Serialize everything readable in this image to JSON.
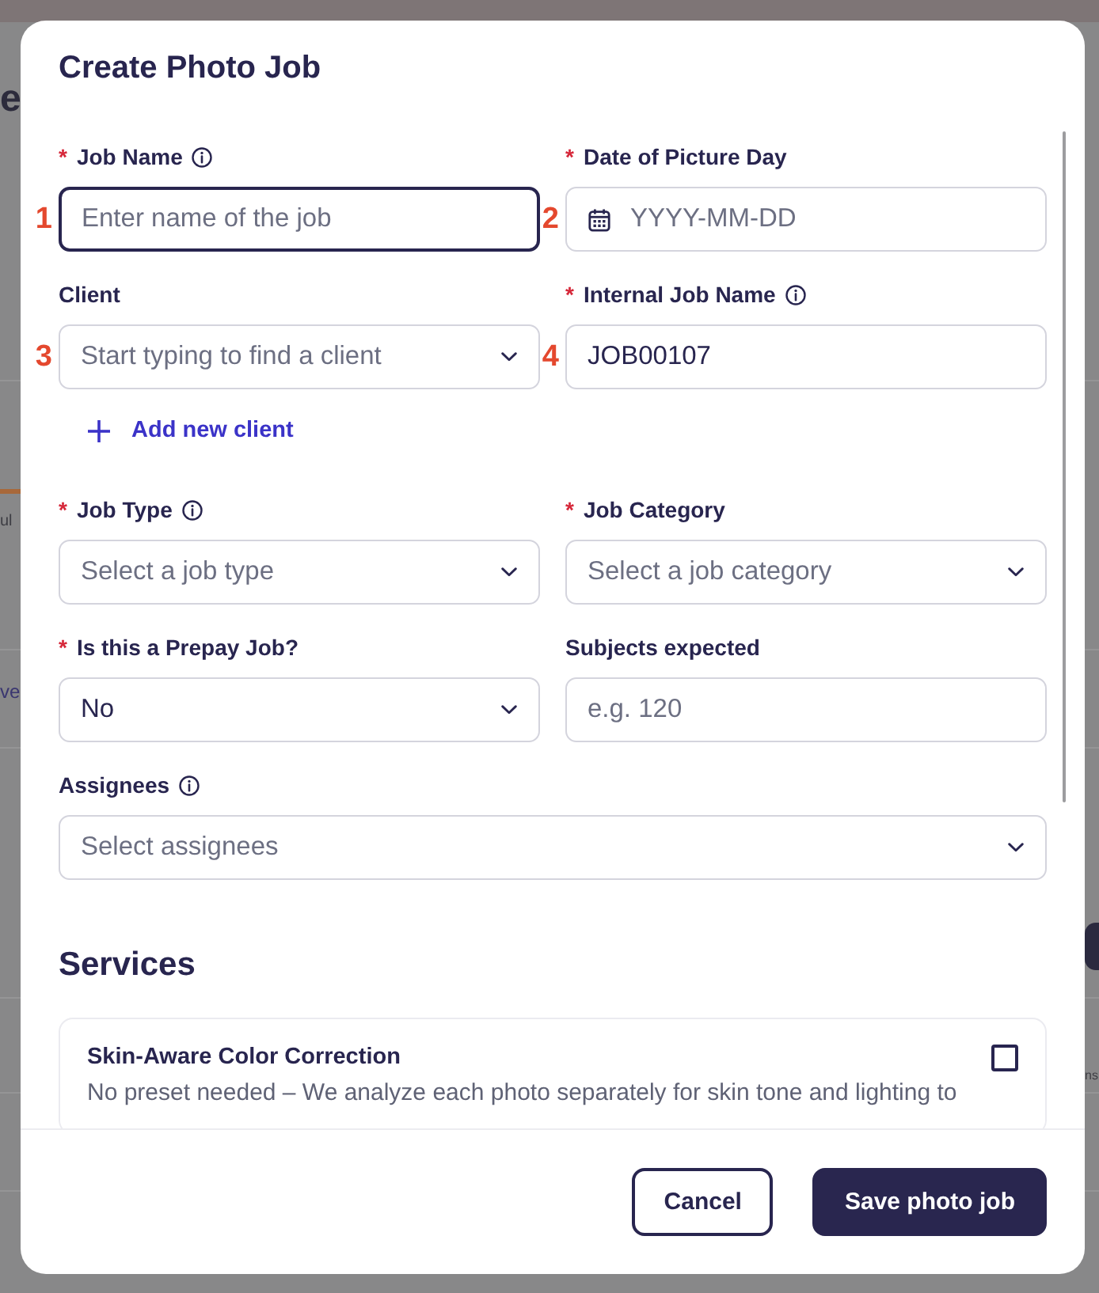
{
  "background_page": {
    "heading_fragment": "e",
    "date_fragment": "ul",
    "link_fragment": "ve",
    "column_fragment": "ns"
  },
  "modal": {
    "title": "Create Photo Job"
  },
  "rows": [
    {
      "fields": [
        {
          "label": "Job Name",
          "required_mark": "*",
          "info": true,
          "kind": "text",
          "placeholder": "Enter name of the job",
          "focused": true,
          "marker": "1"
        },
        {
          "label": "Date of Picture Day",
          "required_mark": "*",
          "info": false,
          "kind": "date",
          "placeholder": "YYYY-MM-DD",
          "focused": false,
          "marker": "2"
        }
      ]
    },
    {
      "fields": [
        {
          "label": "Client",
          "info": false,
          "kind": "combobox",
          "placeholder": "Start typing to find a client",
          "focused": false,
          "marker": "3",
          "action": "Add new client"
        },
        {
          "label": "Internal Job Name",
          "required_mark": "*",
          "info": true,
          "kind": "text",
          "value": "JOB00107",
          "focused": false,
          "marker": "4"
        }
      ]
    },
    {
      "fields": [
        {
          "label": "Job Type",
          "required_mark": "*",
          "info": true,
          "kind": "select",
          "placeholder": "Select a job type",
          "focused": false
        },
        {
          "label": "Job Category",
          "required_mark": "*",
          "info": false,
          "kind": "select",
          "placeholder": "Select a job category",
          "focused": false
        }
      ]
    },
    {
      "fields": [
        {
          "label": "Is this a Prepay Job?",
          "required_mark": "*",
          "info": false,
          "kind": "select",
          "value": "No",
          "focused": false
        },
        {
          "label": "Subjects expected",
          "info": false,
          "kind": "number",
          "placeholder": "e.g. 120",
          "focused": false
        }
      ]
    },
    {
      "fields": [
        {
          "label": "Assignees",
          "info": true,
          "kind": "select",
          "placeholder": "Select assignees",
          "focused": false
        }
      ]
    }
  ],
  "services": {
    "heading": "Services",
    "items": [
      {
        "title": "Skin-Aware Color Correction",
        "description": "No preset needed – We analyze each photo separately for skin tone and lighting to",
        "checked": false
      }
    ]
  },
  "footer": {
    "buttons": [
      {
        "label": "Cancel",
        "kind": "secondary"
      },
      {
        "label": "Save photo job",
        "kind": "primary"
      }
    ]
  }
}
